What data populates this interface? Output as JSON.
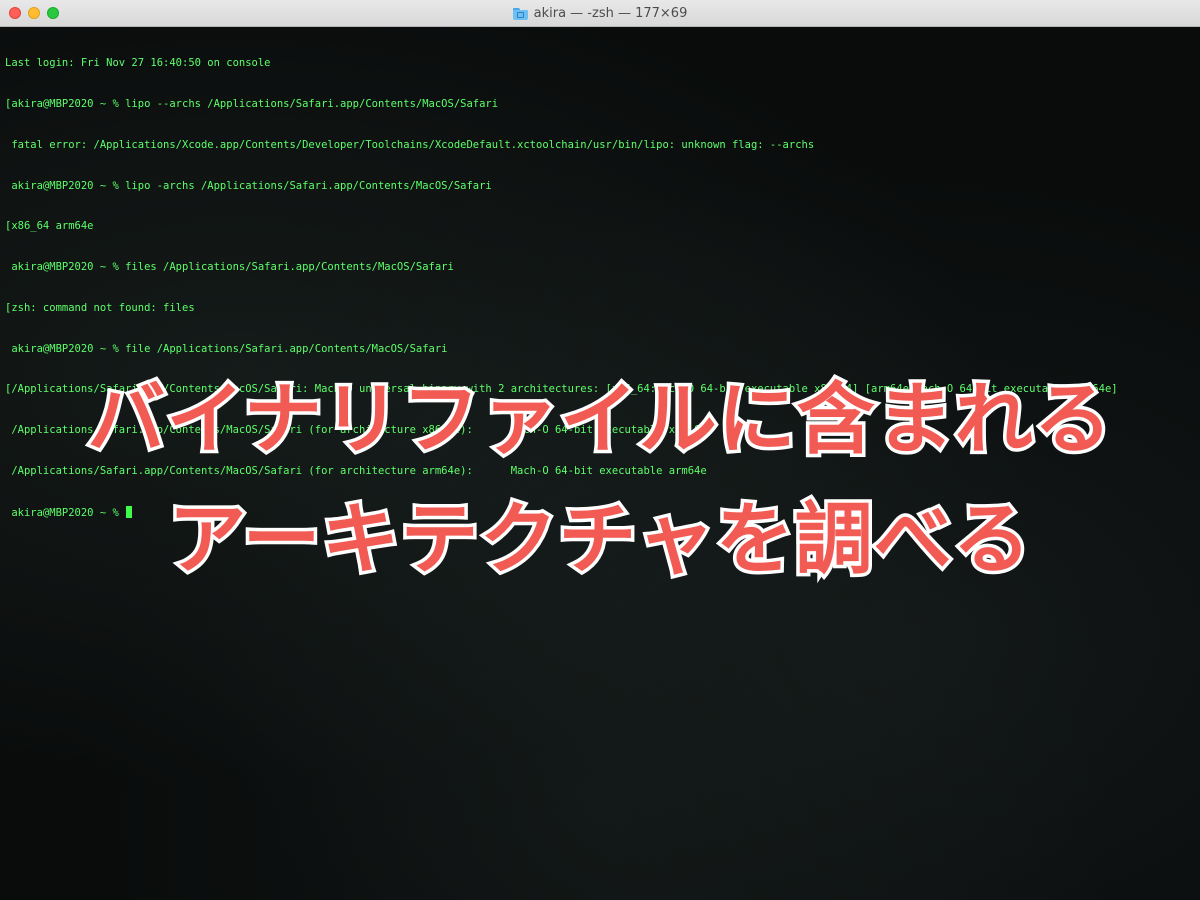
{
  "window": {
    "title": "akira — -zsh — 177×69",
    "title_icon": "folder-icon",
    "traffic_lights": {
      "close_color": "#fe5f57",
      "minimize_color": "#febc2e",
      "zoom_color": "#28c840"
    }
  },
  "terminal": {
    "text_color": "#5dff6a",
    "lines": [
      "Last login: Fri Nov 27 16:40:50 on console",
      "[akira@MBP2020 ~ % lipo --archs /Applications/Safari.app/Contents/MacOS/Safari",
      " fatal error: /Applications/Xcode.app/Contents/Developer/Toolchains/XcodeDefault.xctoolchain/usr/bin/lipo: unknown flag: --archs",
      " akira@MBP2020 ~ % lipo -archs /Applications/Safari.app/Contents/MacOS/Safari",
      "[x86_64 arm64e",
      " akira@MBP2020 ~ % files /Applications/Safari.app/Contents/MacOS/Safari",
      "[zsh: command not found: files",
      " akira@MBP2020 ~ % file /Applications/Safari.app/Contents/MacOS/Safari",
      "[/Applications/Safari.app/Contents/MacOS/Safari: Mach-O universal binary with 2 architectures: [x86_64:Mach-O 64-bit executable x86_64] [arm64e:Mach-O 64-bit executable arm64e]",
      " /Applications/Safari.app/Contents/MacOS/Safari (for architecture x86_64):      Mach-O 64-bit executable x86_64",
      " /Applications/Safari.app/Contents/MacOS/Safari (for architecture arm64e):      Mach-O 64-bit executable arm64e"
    ],
    "prompt": " akira@MBP2020 ~ % "
  },
  "overlay": {
    "line1": "バイナリファイルに含まれる",
    "line2": "アーキテクチャを調べる",
    "text_color": "#f15b54",
    "outline_color": "#ffffff"
  }
}
